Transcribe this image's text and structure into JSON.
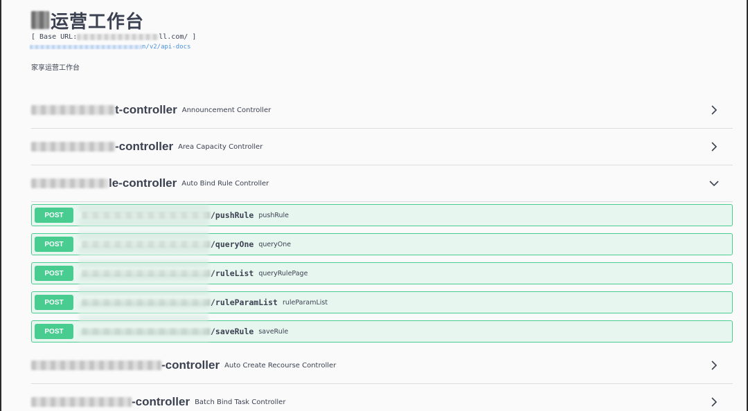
{
  "info": {
    "title": "运营工作台",
    "base_url_prefix": "[ Base URL: ",
    "base_url_suffix": "ll.com/ ]",
    "docs_link_suffix": "n/v2/api-docs",
    "description": "家享运营工作台"
  },
  "tags": [
    {
      "name": "t-controller",
      "description": "Announcement Controller",
      "expanded": false
    },
    {
      "name": "-controller",
      "description": "Area Capacity Controller",
      "expanded": false
    },
    {
      "name": "le-controller",
      "description": "Auto Bind Rule Controller",
      "expanded": true
    },
    {
      "name": "-controller",
      "description": "Auto Create Recourse Controller",
      "expanded": false
    },
    {
      "name": "-controller",
      "description": "Batch Bind Task Controller",
      "expanded": false
    }
  ],
  "operations": [
    {
      "method": "POST",
      "path": "/pushRule",
      "summary": "pushRule"
    },
    {
      "method": "POST",
      "path": "/queryOne",
      "summary": "queryOne"
    },
    {
      "method": "POST",
      "path": "/ruleList",
      "summary": "queryRulePage"
    },
    {
      "method": "POST",
      "path": "/ruleParamList",
      "summary": "ruleParamList"
    },
    {
      "method": "POST",
      "path": "/saveRule",
      "summary": "saveRule"
    }
  ],
  "colors": {
    "post_accent": "#49cc90",
    "post_background": "#e8f6f0",
    "link": "#4990e2",
    "text": "#3b4151"
  },
  "icons": {
    "collapsed": "chevron-right-icon",
    "expanded": "chevron-down-icon"
  }
}
